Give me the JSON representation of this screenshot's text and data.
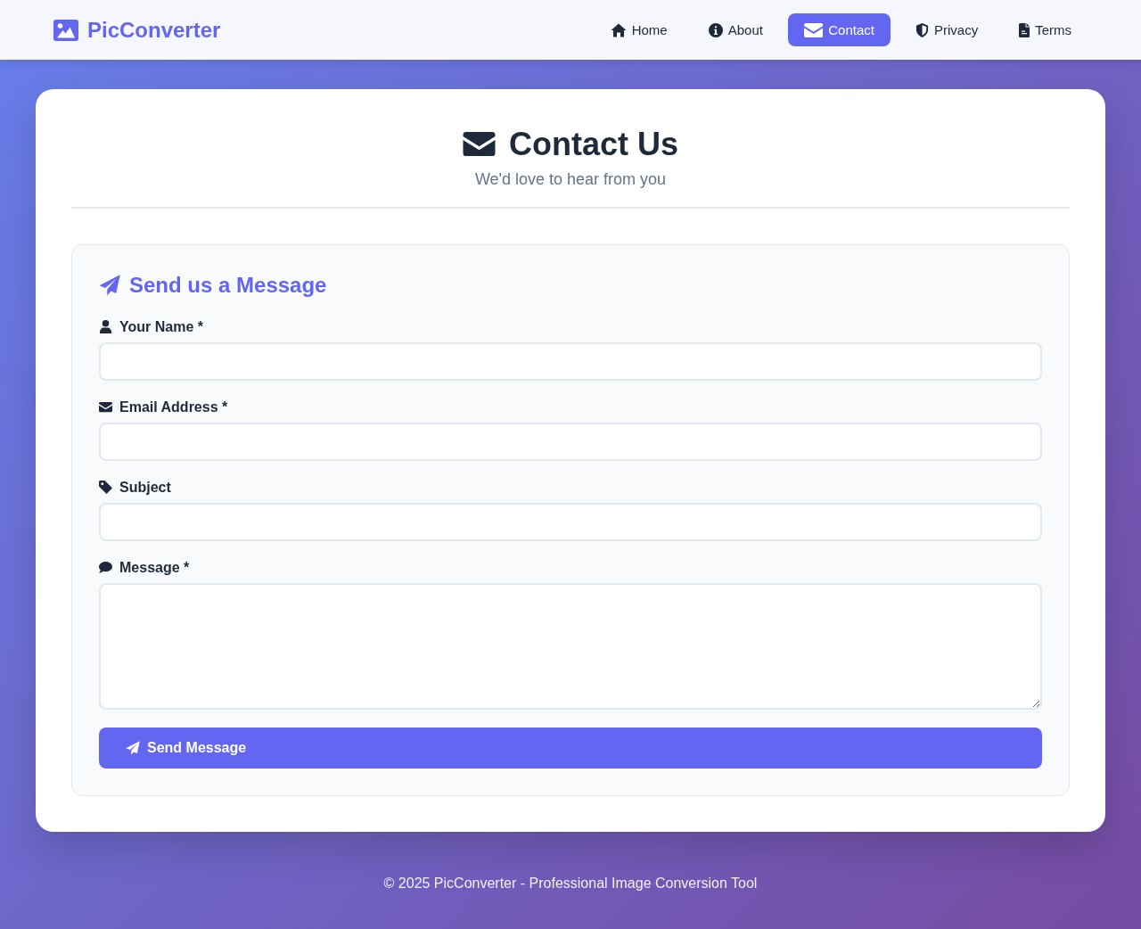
{
  "header": {
    "logo": "PicConverter",
    "nav": [
      {
        "label": "Home",
        "selected": false
      },
      {
        "label": "About",
        "selected": false
      },
      {
        "label": "Contact",
        "selected": true
      },
      {
        "label": "Privacy",
        "selected": false
      },
      {
        "label": "Terms",
        "selected": false
      }
    ]
  },
  "page": {
    "title": "Contact Us",
    "subtitle": "We'd love to hear from you"
  },
  "form": {
    "title": "Send us a Message",
    "fields": [
      {
        "kind": "input",
        "label": "Your Name *"
      },
      {
        "kind": "input",
        "label": "Email Address *"
      },
      {
        "kind": "input",
        "label": "Subject"
      },
      {
        "kind": "textarea",
        "label": "Message *"
      }
    ],
    "submit": "Send Message"
  },
  "footer": "© 2025 PicConverter - Professional Image Conversion Tool"
}
